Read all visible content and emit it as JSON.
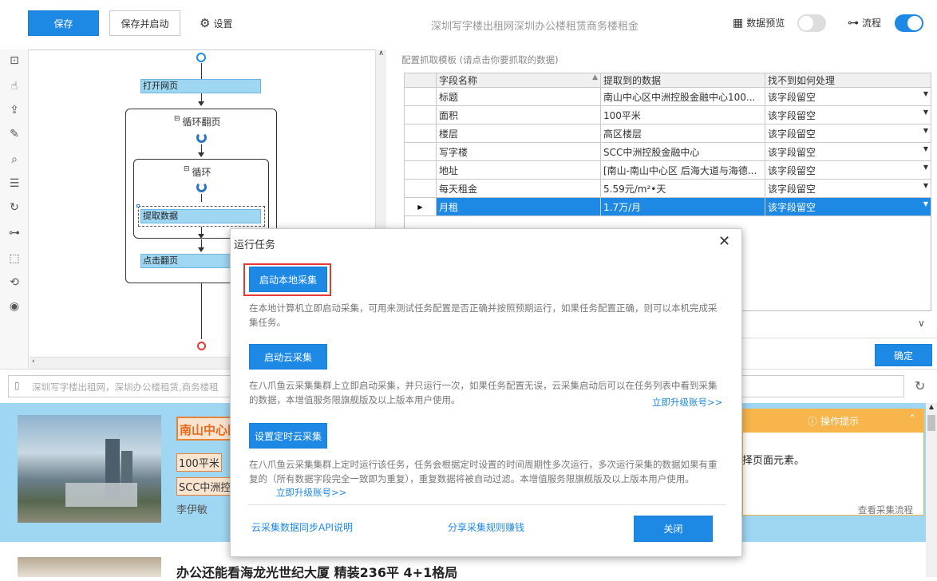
{
  "toolbar": {
    "save_label": "保存",
    "save_start_label": "保存并启动",
    "settings_label": "设置",
    "task_title": "深圳写字楼出租网深圳办公楼租赁商务楼租金",
    "data_preview_label": "数据预览",
    "data_preview_on": false,
    "flow_label": "流程",
    "flow_on": true,
    "accent_color": "#1e88e5"
  },
  "flow": {
    "nodes": {
      "open_page": "打开网页",
      "loop_page": "循环翻页",
      "loop": "循环",
      "extract": "提取数据",
      "click_next": "点击翻页"
    }
  },
  "template": {
    "caption": "配置抓取模板 (请点击你要抓取的数据)",
    "columns": [
      "字段名称",
      "提取到的数据",
      "找不到如何处理"
    ],
    "rows": [
      {
        "name": "标题",
        "value": "南山中心区中洲控股金融中心100...",
        "action": "该字段留空"
      },
      {
        "name": "面积",
        "value": "100平米",
        "action": "该字段留空"
      },
      {
        "name": "楼层",
        "value": "高区楼层",
        "action": "该字段留空"
      },
      {
        "name": "写字楼",
        "value": "SCC中洲控股金融中心",
        "action": "该字段留空"
      },
      {
        "name": "地址",
        "value": "[南山-南山中心区 后海大道与海德...",
        "action": "该字段留空"
      },
      {
        "name": "每天租金",
        "value": "5.59元/m²•天",
        "action": "该字段留空"
      },
      {
        "name": "月租",
        "value": "1.7万/月",
        "action": "该字段留空",
        "selected": true
      }
    ],
    "confirm_label": "确定"
  },
  "browser": {
    "url": "深圳写字楼出租网，深圳办公楼租赁,商务楼租",
    "listing": {
      "title": "南山中心区",
      "area": "100平米",
      "building": "SCC中洲控",
      "agent": "李伊敏"
    },
    "tips_title": "操作提示",
    "tips_text": "择页面元素。",
    "tips_link": "查看采集流程",
    "listing2_title": "办公还能看海龙光世纪大厦 精装236平 4+1格局"
  },
  "modal": {
    "title": "运行任务",
    "local_button": "启动本地采集",
    "local_desc": "在本地计算机立即启动采集，可用来测试任务配置是否正确并按照预期运行，如果任务配置正确，则可以本机完成采集任务。",
    "cloud_button": "启动云采集",
    "cloud_desc": "在八爪鱼云采集集群上立即启动采集，并只运行一次，如果任务配置无误，云采集启动后可以在任务列表中看到采集的数据，本增值服务限旗舰版及以上版本用户使用。",
    "cloud_upgrade": "立即升级账号>>",
    "schedule_button": "设置定时云采集",
    "schedule_desc": "在八爪鱼云采集集群上定时运行该任务，任务会根据定时设置的时间周期性多次运行，多次运行采集的数据如果有重复的（所有数据字段完全一致即为重复），重复数据将被自动过滤。本增值服务限旗舰版及以上版本用户使用。",
    "schedule_upgrade": "立即升级账号>>",
    "api_link": "云采集数据同步API说明",
    "share_link": "分享采集规则赚钱",
    "close_label": "关闭"
  }
}
